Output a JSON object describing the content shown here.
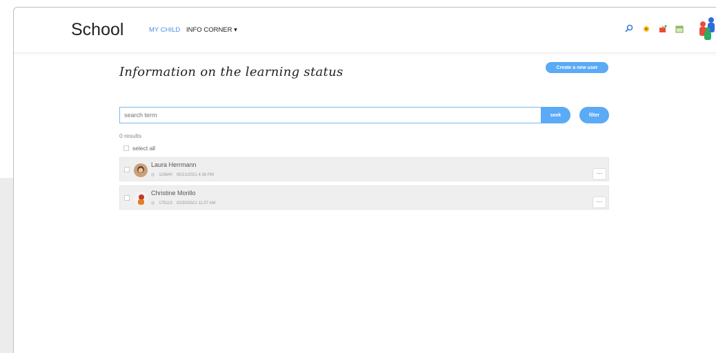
{
  "header": {
    "brand": "School",
    "nav": {
      "my_child": "MY CHILD",
      "info_corner": "INFO CORNER",
      "info_caret": "▾"
    },
    "icons": [
      "search-icon",
      "settings-icon",
      "notification-icon",
      "calendar-icon",
      "user-group-avatar-icon"
    ],
    "accent": "#4a90e2"
  },
  "page": {
    "title": "Information on the learning status",
    "create_button": "Create a new user",
    "search": {
      "value": "",
      "placeholder": "search term"
    },
    "seek_button": "seek",
    "filter_button": "filter",
    "results_count": "0 results",
    "select_all": "select all"
  },
  "list": [
    {
      "name": "Laura Herrmann",
      "id": "116640",
      "date": "00/21/2021 4:36 PM",
      "more": "···"
    },
    {
      "name": "Christine Morillo",
      "id": "175113",
      "date": "02/30/2021 11:37 AM",
      "more": "···"
    }
  ],
  "colors": {
    "button": "#5aaaf5",
    "row_bg": "#efefef"
  }
}
